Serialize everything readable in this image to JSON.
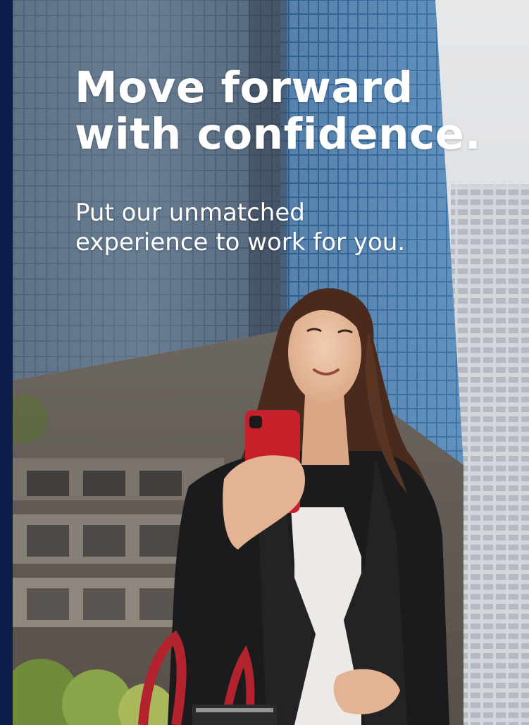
{
  "hero": {
    "headline_line1": "Move forward",
    "headline_line2": "with confidence.",
    "subhead_line1": "Put our unmatched",
    "subhead_line2": "experience to work for you."
  },
  "colors": {
    "navy": "#0b1f4a",
    "text": "#ffffff"
  },
  "photo": {
    "subject": "woman-holding-red-phone-icon"
  }
}
